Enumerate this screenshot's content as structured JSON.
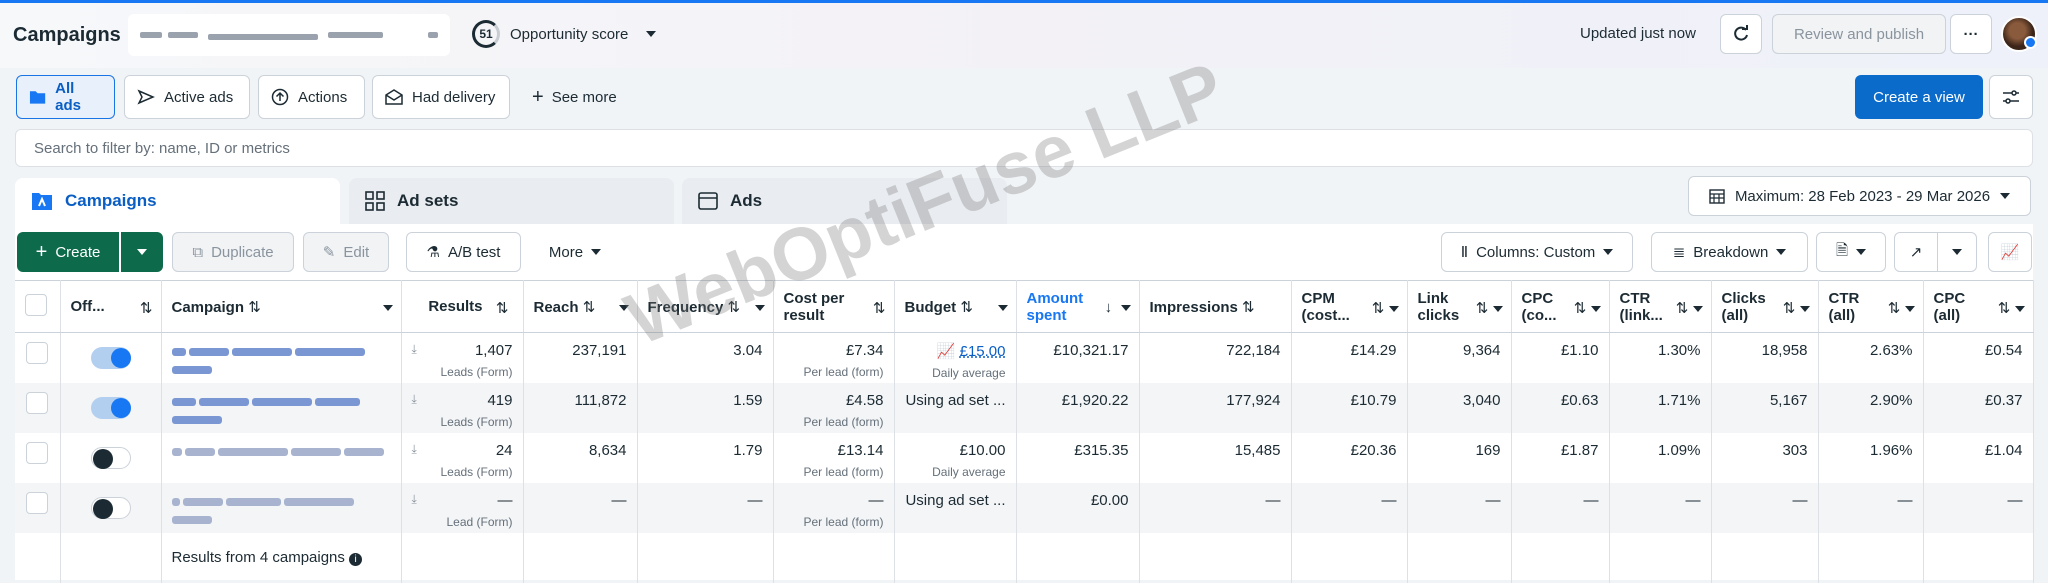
{
  "header": {
    "title": "Campaigns",
    "opportunity_score": "51",
    "opportunity_label": "Opportunity score",
    "updated": "Updated just now",
    "review_label": "Review and publish",
    "more_label": "···"
  },
  "filters": {
    "chips": [
      "All ads",
      "Active ads",
      "Actions",
      "Had delivery"
    ],
    "see_more": "See more",
    "create_view": "Create a view"
  },
  "search": {
    "placeholder": "Search to filter by: name, ID or metrics"
  },
  "tabs": {
    "campaigns": "Campaigns",
    "ad_sets": "Ad sets",
    "ads": "Ads"
  },
  "date_range": "Maximum: 28 Feb 2023 - 29 Mar 2026",
  "toolbar": {
    "create": "Create",
    "duplicate": "Duplicate",
    "edit": "Edit",
    "ab_test": "A/B test",
    "more": "More",
    "columns": "Columns: Custom",
    "breakdown": "Breakdown"
  },
  "watermark": "WebOptiFuse LLP",
  "table": {
    "headers": {
      "off_on": "Off...",
      "campaign": "Campaign",
      "results": "Results",
      "reach": "Reach",
      "frequency": "Frequency",
      "cost_per_result_1": "Cost per",
      "cost_per_result_2": "result",
      "budget": "Budget",
      "amount_spent_1": "Amount",
      "amount_spent_2": "spent",
      "impressions": "Impressions",
      "cpm_1": "CPM",
      "cpm_2": "(cost...",
      "link_clicks_1": "Link",
      "link_clicks_2": "clicks",
      "cpc_1": "CPC",
      "cpc_2": "(co...",
      "ctr_link_1": "CTR",
      "ctr_link_2": "(link...",
      "clicks_all_1": "Clicks",
      "clicks_all_2": "(all)",
      "ctr_all_1": "CTR",
      "ctr_all_2": "(all)",
      "cpc_all_1": "CPC",
      "cpc_all_2": "(all)"
    },
    "rows": [
      {
        "on": true,
        "results": "1,407",
        "results_sub": "Leads (Form)",
        "reach": "237,191",
        "frequency": "3.04",
        "cpr": "£7.34",
        "cpr_sub": "Per lead (form)",
        "budget": "£15.00",
        "budget_sub": "Daily average",
        "spent": "£10,321.17",
        "impressions": "722,184",
        "cpm": "£14.29",
        "link_clicks": "9,364",
        "cpc": "£1.10",
        "ctr_link": "1.30%",
        "clicks_all": "18,958",
        "ctr_all": "2.63%",
        "cpc_all": "£0.54"
      },
      {
        "on": true,
        "results": "419",
        "results_sub": "Leads (Form)",
        "reach": "111,872",
        "frequency": "1.59",
        "cpr": "£4.58",
        "cpr_sub": "Per lead (form)",
        "budget": "Using ad set ...",
        "budget_sub": "",
        "spent": "£1,920.22",
        "impressions": "177,924",
        "cpm": "£10.79",
        "link_clicks": "3,040",
        "cpc": "£0.63",
        "ctr_link": "1.71%",
        "clicks_all": "5,167",
        "ctr_all": "2.90%",
        "cpc_all": "£0.37"
      },
      {
        "on": false,
        "results": "24",
        "results_sub": "Leads (Form)",
        "reach": "8,634",
        "frequency": "1.79",
        "cpr": "£13.14",
        "cpr_sub": "Per lead (form)",
        "budget": "£10.00",
        "budget_sub": "Daily average",
        "spent": "£315.35",
        "impressions": "15,485",
        "cpm": "£20.36",
        "link_clicks": "169",
        "cpc": "£1.87",
        "ctr_link": "1.09%",
        "clicks_all": "303",
        "ctr_all": "1.96%",
        "cpc_all": "£1.04"
      },
      {
        "on": false,
        "results": "—",
        "results_sub": "Lead (Form)",
        "reach": "—",
        "frequency": "—",
        "cpr": "—",
        "cpr_sub": "Per lead (form)",
        "budget": "Using ad set ...",
        "budget_sub": "",
        "spent": "£0.00",
        "impressions": "—",
        "cpm": "—",
        "link_clicks": "—",
        "cpc": "—",
        "ctr_link": "—",
        "clicks_all": "—",
        "ctr_all": "—",
        "cpc_all": "—"
      }
    ],
    "footer": "Results from 4 campaigns"
  },
  "colors": {
    "accent": "#1877f2",
    "create": "#0d6b4c",
    "primary": "#0b6bcb"
  }
}
